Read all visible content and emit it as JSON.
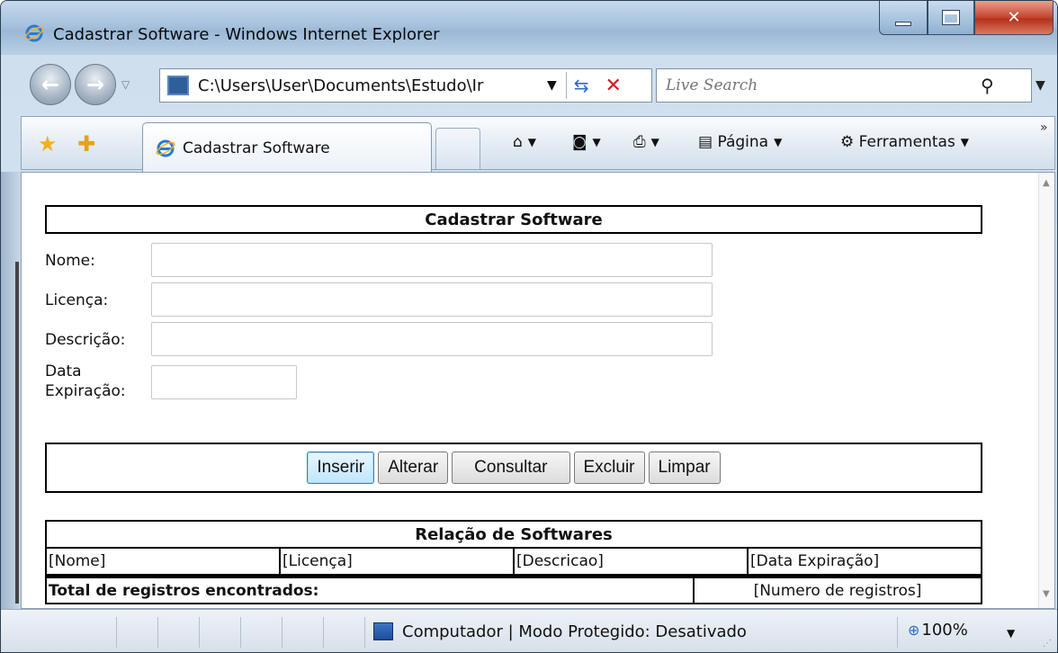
{
  "window": {
    "title": "Cadastrar Software - Windows Internet Explorer"
  },
  "nav": {
    "address": "C:\\Users\\User\\Documents\\Estudo\\Ir",
    "search_placeholder": "Live Search"
  },
  "tabs": [
    {
      "label": "Cadastrar Software",
      "active": true
    }
  ],
  "commands": {
    "page_label": "Página",
    "tools_label": "Ferramentas"
  },
  "form": {
    "title": "Cadastrar Software",
    "fields": [
      {
        "label": "Nome:",
        "value": ""
      },
      {
        "label": "Licença:",
        "value": ""
      },
      {
        "label": "Descrição:",
        "value": ""
      }
    ],
    "expiry_label_line1": "Data",
    "expiry_label_line2": "Expiração:",
    "expiry_value": "",
    "buttons": [
      {
        "label": "Inserir"
      },
      {
        "label": "Alterar"
      },
      {
        "label": "Consultar"
      },
      {
        "label": "Excluir"
      },
      {
        "label": "Limpar"
      }
    ]
  },
  "list": {
    "title": "Relação de Softwares",
    "columns": [
      "[Nome]",
      "[Licença]",
      "[Descricao]",
      "[Data Expiração]"
    ],
    "total_label": "Total de registros encontrados:",
    "total_value": "[Numero de registros]"
  },
  "status": {
    "text": "Computador | Modo Protegido: Desativado",
    "zoom": "100%"
  },
  "colors": {
    "accent": "#2a6cc4",
    "primary_button": "#bee6fd",
    "close_button": "#c4442c"
  }
}
